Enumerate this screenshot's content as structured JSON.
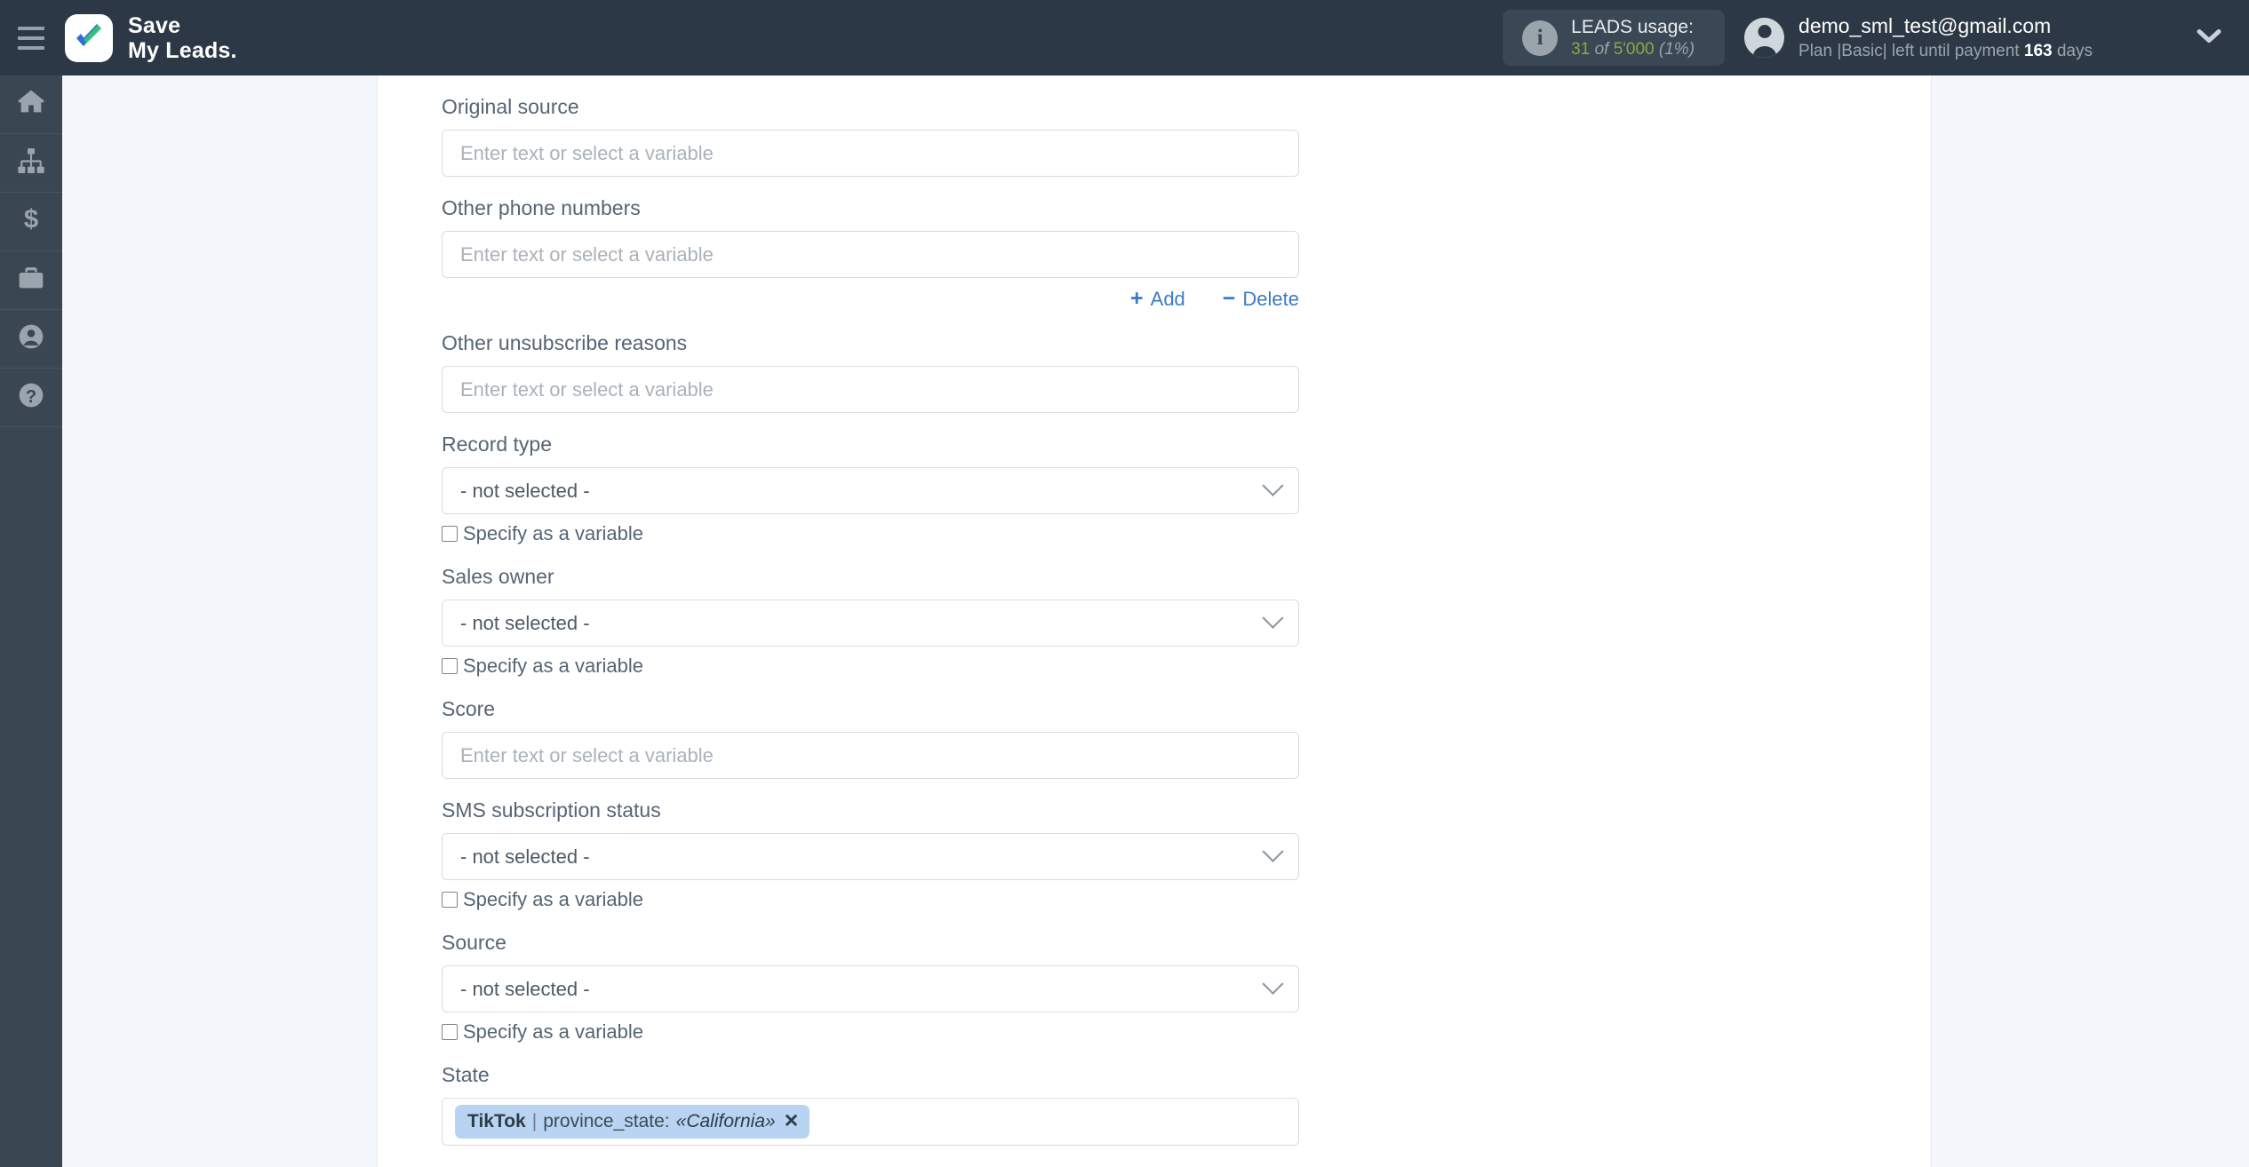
{
  "header": {
    "menu_icon": "hamburger-icon",
    "brand_line1": "Save",
    "brand_line2": "My Leads",
    "brand_dot": ".",
    "usage": {
      "info_icon": "info-icon",
      "title": "LEADS usage:",
      "used": "31",
      "of": "of",
      "total": "5'000",
      "percent": "(1%)"
    },
    "account": {
      "avatar_icon": "user-avatar-icon",
      "email": "demo_sml_test@gmail.com",
      "plan_prefix": "Plan |Basic| left until payment",
      "plan_days": "163",
      "plan_suffix": "days"
    },
    "chevron_icon": "chevron-down-icon"
  },
  "sidebar": {
    "items": [
      {
        "icon": "home-icon",
        "name": "sidebar-item-home"
      },
      {
        "icon": "connections-icon",
        "name": "sidebar-item-connections"
      },
      {
        "icon": "dollar-icon",
        "name": "sidebar-item-billing"
      },
      {
        "icon": "briefcase-icon",
        "name": "sidebar-item-business"
      },
      {
        "icon": "account-icon",
        "name": "sidebar-item-account"
      },
      {
        "icon": "help-icon",
        "name": "sidebar-item-help"
      }
    ]
  },
  "form": {
    "placeholder": "Enter text or select a variable",
    "not_selected": "- not selected -",
    "checkbox_label": "Specify as a variable",
    "add_label": "Add",
    "add_sign": "+",
    "delete_label": "Delete",
    "delete_sign": "−",
    "fields": [
      {
        "label": "Original source",
        "type": "text"
      },
      {
        "label": "Other phone numbers",
        "type": "text",
        "links": true
      },
      {
        "label": "Other unsubscribe reasons",
        "type": "text"
      },
      {
        "label": "Record type",
        "type": "select",
        "checkbox": true
      },
      {
        "label": "Sales owner",
        "type": "select",
        "checkbox": true
      },
      {
        "label": "Score",
        "type": "text"
      },
      {
        "label": "SMS subscription status",
        "type": "select",
        "checkbox": true
      },
      {
        "label": "Source",
        "type": "select",
        "checkbox": true
      },
      {
        "label": "State",
        "type": "tag"
      }
    ],
    "state_tag": {
      "source": "TikTok",
      "separator": "|",
      "key": "province_state:",
      "value": "«California»",
      "remove_icon": "close-icon",
      "remove_label": "✕"
    }
  },
  "colors": {
    "header_bg": "#2c3845",
    "sidebar_bg": "#3a4652",
    "page_bg": "#f4f7fb",
    "link": "#3a7bc4",
    "tag_bg": "#b9d4f2",
    "usage_green": "#8aa944"
  }
}
